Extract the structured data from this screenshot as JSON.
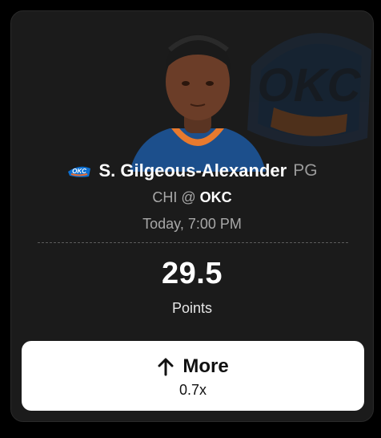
{
  "player": {
    "name": "S. Gilgeous-Alexander",
    "position": "PG",
    "team_logo": "okc-thunder-logo"
  },
  "game": {
    "away": "CHI",
    "separator": "@",
    "home": "OKC",
    "time": "Today, 7:00 PM"
  },
  "projection": {
    "line": "29.5",
    "stat": "Points"
  },
  "pick": {
    "label": "More",
    "multiplier": "0.7x",
    "icon": "arrow-up-icon"
  },
  "colors": {
    "card_bg": "#1b1b1b",
    "thunder_blue": "#0c6fd1",
    "thunder_orange": "#ef6b2b",
    "button_bg": "#ffffff"
  }
}
